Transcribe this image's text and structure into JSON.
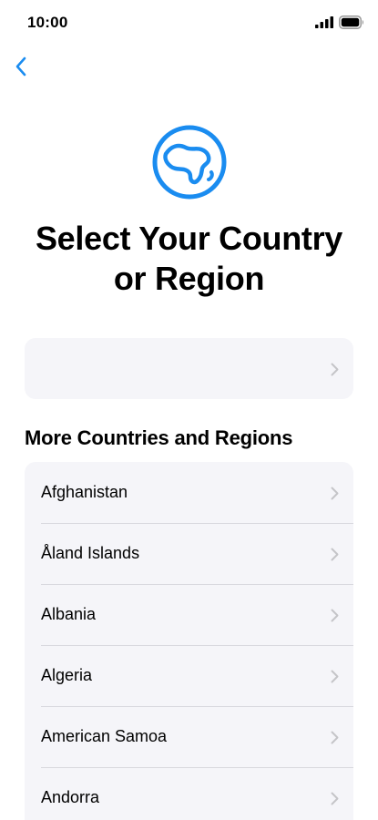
{
  "status_bar": {
    "time": "10:00",
    "signal_icon": "cellular-signal-icon",
    "battery_icon": "battery-full-icon"
  },
  "navigation": {
    "back_icon": "chevron-left-icon"
  },
  "header": {
    "icon": "globe-icon",
    "title_line1": "Select Your Country",
    "title_line2": "or Region"
  },
  "suggested": {
    "label": "",
    "icon": "chevron-right-icon"
  },
  "section": {
    "title": "More Countries and Regions"
  },
  "countries": [
    {
      "label": "Afghanistan"
    },
    {
      "label": "Åland Islands"
    },
    {
      "label": "Albania"
    },
    {
      "label": "Algeria"
    },
    {
      "label": "American Samoa"
    },
    {
      "label": "Andorra"
    }
  ],
  "colors": {
    "accent": "#1a8cf0",
    "card_background": "#f5f5f9",
    "separator": "#d8d8de",
    "chevron": "#c4c4c8"
  }
}
